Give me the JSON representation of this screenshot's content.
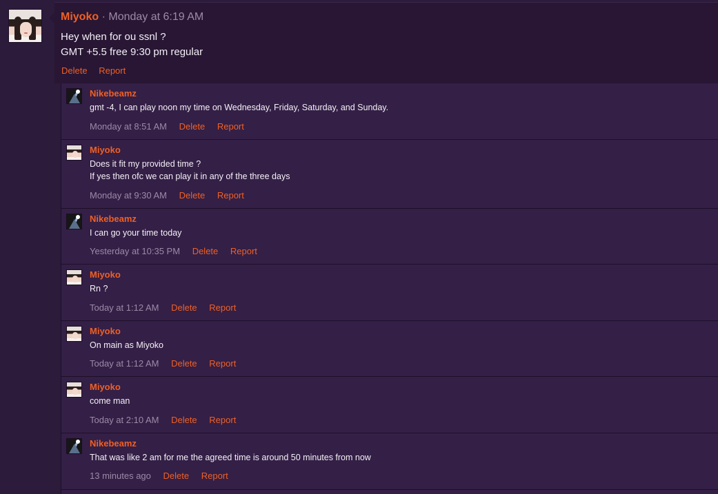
{
  "post": {
    "author": "Miyoko",
    "separator": "·",
    "timestamp": "Monday at 6:19 AM",
    "lines": [
      "Hey when for ou ssnl ?",
      "GMT +5.5 free 9:30 pm regular"
    ],
    "delete_label": "Delete",
    "report_label": "Report"
  },
  "comments": [
    {
      "author": "Nikebeamz",
      "avatar": "nikebeamz-avatar",
      "lines": [
        "gmt -4, I can play noon my time on Wednesday, Friday, Saturday, and Sunday."
      ],
      "time": "Monday at 8:51 AM",
      "delete_label": "Delete",
      "report_label": "Report"
    },
    {
      "author": "Miyoko",
      "avatar": "miyoko-avatar",
      "lines": [
        "Does it fit my provided time ?",
        "If yes then ofc we can play it in any of the three days"
      ],
      "time": "Monday at 9:30 AM",
      "delete_label": "Delete",
      "report_label": "Report"
    },
    {
      "author": "Nikebeamz",
      "avatar": "nikebeamz-avatar",
      "lines": [
        "I can go your time today"
      ],
      "time": "Yesterday at 10:35 PM",
      "delete_label": "Delete",
      "report_label": "Report"
    },
    {
      "author": "Miyoko",
      "avatar": "miyoko-avatar",
      "lines": [
        "Rn ?"
      ],
      "time": "Today at 1:12 AM",
      "delete_label": "Delete",
      "report_label": "Report"
    },
    {
      "author": "Miyoko",
      "avatar": "miyoko-avatar",
      "lines": [
        "On main as Miyoko"
      ],
      "time": "Today at 1:12 AM",
      "delete_label": "Delete",
      "report_label": "Report"
    },
    {
      "author": "Miyoko",
      "avatar": "miyoko-avatar",
      "lines": [
        "come man"
      ],
      "time": "Today at 2:10 AM",
      "delete_label": "Delete",
      "report_label": "Report"
    },
    {
      "author": "Nikebeamz",
      "avatar": "nikebeamz-avatar",
      "lines": [
        "That was like 2 am for me the agreed time is around 50 minutes from now"
      ],
      "time": "13 minutes ago",
      "delete_label": "Delete",
      "report_label": "Report"
    }
  ],
  "colors": {
    "accent": "#f06023",
    "background": "#2c1b3b",
    "comment_bg": "#341f46",
    "muted_text": "#9c8aa7"
  }
}
